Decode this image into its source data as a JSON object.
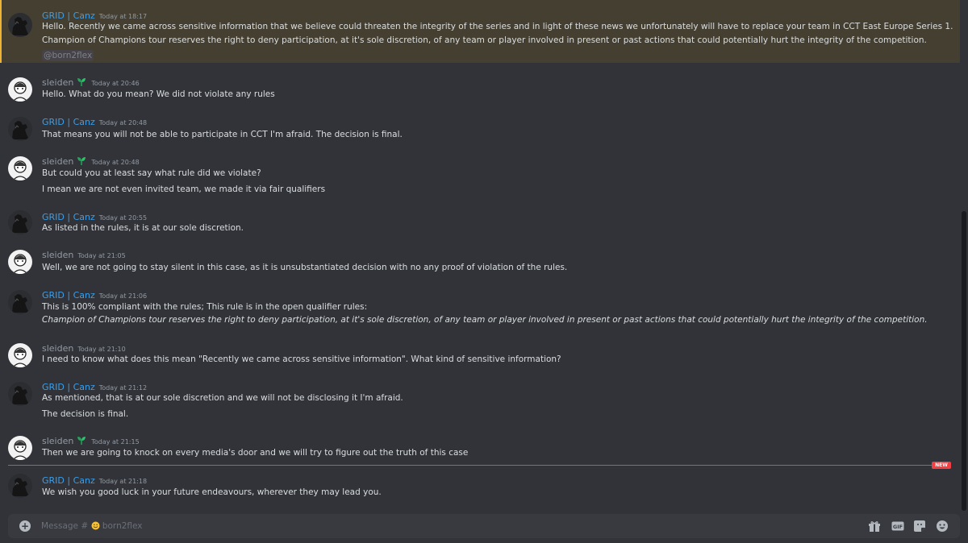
{
  "messages": [
    {
      "author": "GRID | Canz",
      "timestamp": "Today at 18:17",
      "lines": [
        "Hello. Recently we came across sensitive information that we believe could threaten the integrity of the series and in light of these news we unfortunately will have to replace your team in CCT East Europe Series 1.",
        "Champion of Champions tour reserves the right to deny participation, at it's sole discretion, of any team or player involved in present or past actions that could potentially hurt the integrity of the competition."
      ],
      "mention": "@born2flex"
    },
    {
      "author": "sleiden",
      "timestamp": "Today at 20:46",
      "lines": [
        "Hello. What do you mean? We did not violate any rules"
      ]
    },
    {
      "author": "GRID | Canz",
      "timestamp": "Today at 20:48",
      "lines": [
        "That means you will not be able to participate in CCT I'm afraid. The decision is final."
      ]
    },
    {
      "author": "sleiden",
      "timestamp": "Today at 20:48",
      "lines": [
        "But could you at least say what rule did we violate?",
        "I mean we are not even invited team, we made it via fair qualifiers"
      ]
    },
    {
      "author": "GRID | Canz",
      "timestamp": "Today at 20:55",
      "lines": [
        "As listed in the rules, it is at our sole discretion."
      ]
    },
    {
      "author": "sleiden",
      "timestamp": "Today at 21:05",
      "lines": [
        "Well, we are not going to stay silent in this case, as it is unsubstantiated decision with no any proof of violation of the rules."
      ]
    },
    {
      "author": "GRID | Canz",
      "timestamp": "Today at 21:06",
      "lines": [
        "This is 100% compliant with the rules; This rule is in the open qualifier rules:",
        "Champion of Champions tour reserves the right to deny participation, at it's sole discretion, of any team or player involved in present or past actions that could potentially hurt the integrity of the competition."
      ]
    },
    {
      "author": "sleiden",
      "timestamp": "Today at 21:10",
      "lines": [
        "I need to know what does this mean \"Recently we came across sensitive information\". What kind of sensitive information?"
      ]
    },
    {
      "author": "GRID | Canz",
      "timestamp": "Today at 21:12",
      "lines": [
        "As mentioned, that is at our sole discretion and we will not be disclosing it I'm afraid.",
        "The decision is final."
      ]
    },
    {
      "author": "sleiden",
      "timestamp": "Today at 21:15",
      "lines": [
        "Then we are going to knock on every media's door and we will try to figure out the truth of this case"
      ]
    },
    {
      "author": "GRID | Canz",
      "timestamp": "Today at 21:18",
      "lines": [
        "We wish you good luck in your future endeavours, wherever they may lead you."
      ]
    }
  ],
  "new_divider_label": "NEW",
  "composer": {
    "placeholder_prefix": "Message #",
    "channel": "born2flex",
    "channel_icon": "smiley-emoji"
  },
  "toolbar_icons": [
    "gift-icon",
    "gif-icon",
    "sticker-icon",
    "emoji-icon"
  ],
  "colors": {
    "background": "#313338",
    "grid_name": "#3c9ee8",
    "sleiden_name": "#949ba4",
    "mention_bg": "#443f31",
    "new_divider": "#f23f43",
    "badge_green": "#23a55a"
  }
}
